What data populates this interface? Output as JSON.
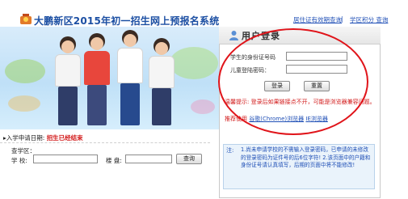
{
  "header": {
    "site_title": "大鹏新区2015年初一招生网上预报名系统",
    "link_status_query": "居住证有效期查询",
    "link_separator": "|",
    "link_school_points": "学区积分 查询"
  },
  "login": {
    "title": "用户登录",
    "id_label": "学生的身份证号码",
    "password_label": "儿童登陆密码：",
    "id_value": "",
    "password_value": "",
    "login_button": "登录",
    "reset_button": "重置",
    "warning": "温馨提示: 登录后如果链接点不开，可能是浏览器兼容问题。",
    "recommend_prefix": "推荐使用",
    "recommend_link1": "谷歌(Chrome)浏览器",
    "recommend_link2": "IE浏览器"
  },
  "notice": {
    "label": "注:",
    "text": "1.尚未申请学校的不需输入登录密码，已申请的未修改的登录密码为证件号的后6位字符! 2.该页面中的户籍和身份证号请认真填写，后期的页面中将不能修改!"
  },
  "enrollment": {
    "date_prefix": "▸入学申请日期:",
    "date_status": "招生已经结束"
  },
  "school_query": {
    "section_label": "查学区：",
    "school_label": "学 校:",
    "code_label": "楼 盘:",
    "query_button": "查询"
  },
  "colors": {
    "title_blue": "#1c4fa3",
    "link_blue": "#1f4fb6",
    "warn_red": "#d21a1a",
    "highlight_red": "#e0141a"
  }
}
